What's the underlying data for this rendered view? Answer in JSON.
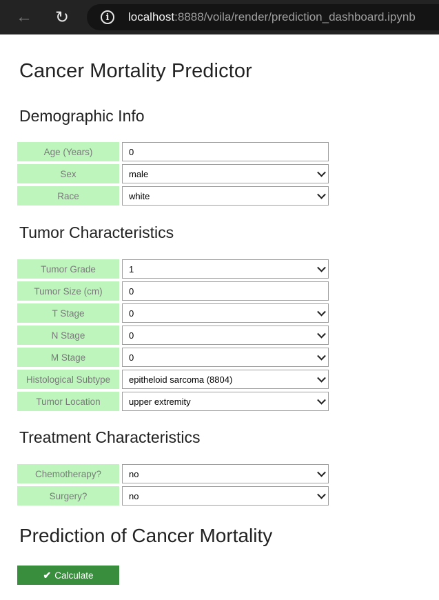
{
  "browser": {
    "url_host": "localhost",
    "url_path": ":8888/voila/render/prediction_dashboard.ipynb"
  },
  "page": {
    "title": "Cancer Mortality Predictor"
  },
  "sections": {
    "demographic": {
      "title": "Demographic Info",
      "fields": [
        {
          "label": "Age (Years)",
          "value": "0",
          "type": "text"
        },
        {
          "label": "Sex",
          "value": "male",
          "type": "select"
        },
        {
          "label": "Race",
          "value": "white",
          "type": "select"
        }
      ]
    },
    "tumor": {
      "title": "Tumor Characteristics",
      "fields": [
        {
          "label": "Tumor Grade",
          "value": "1",
          "type": "select"
        },
        {
          "label": "Tumor Size (cm)",
          "value": "0",
          "type": "text"
        },
        {
          "label": "T Stage",
          "value": "0",
          "type": "select"
        },
        {
          "label": "N Stage",
          "value": "0",
          "type": "select"
        },
        {
          "label": "M Stage",
          "value": "0",
          "type": "select"
        },
        {
          "label": "Histological Subtype",
          "value": "epitheloid sarcoma (8804)",
          "type": "select"
        },
        {
          "label": "Tumor Location",
          "value": "upper extremity",
          "type": "select"
        }
      ]
    },
    "treatment": {
      "title": "Treatment Characteristics",
      "fields": [
        {
          "label": "Chemotherapy?",
          "value": "no",
          "type": "select"
        },
        {
          "label": "Surgery?",
          "value": "no",
          "type": "select"
        }
      ]
    },
    "prediction": {
      "title": "Prediction of Cancer Mortality",
      "button_label": "Calculate"
    }
  }
}
